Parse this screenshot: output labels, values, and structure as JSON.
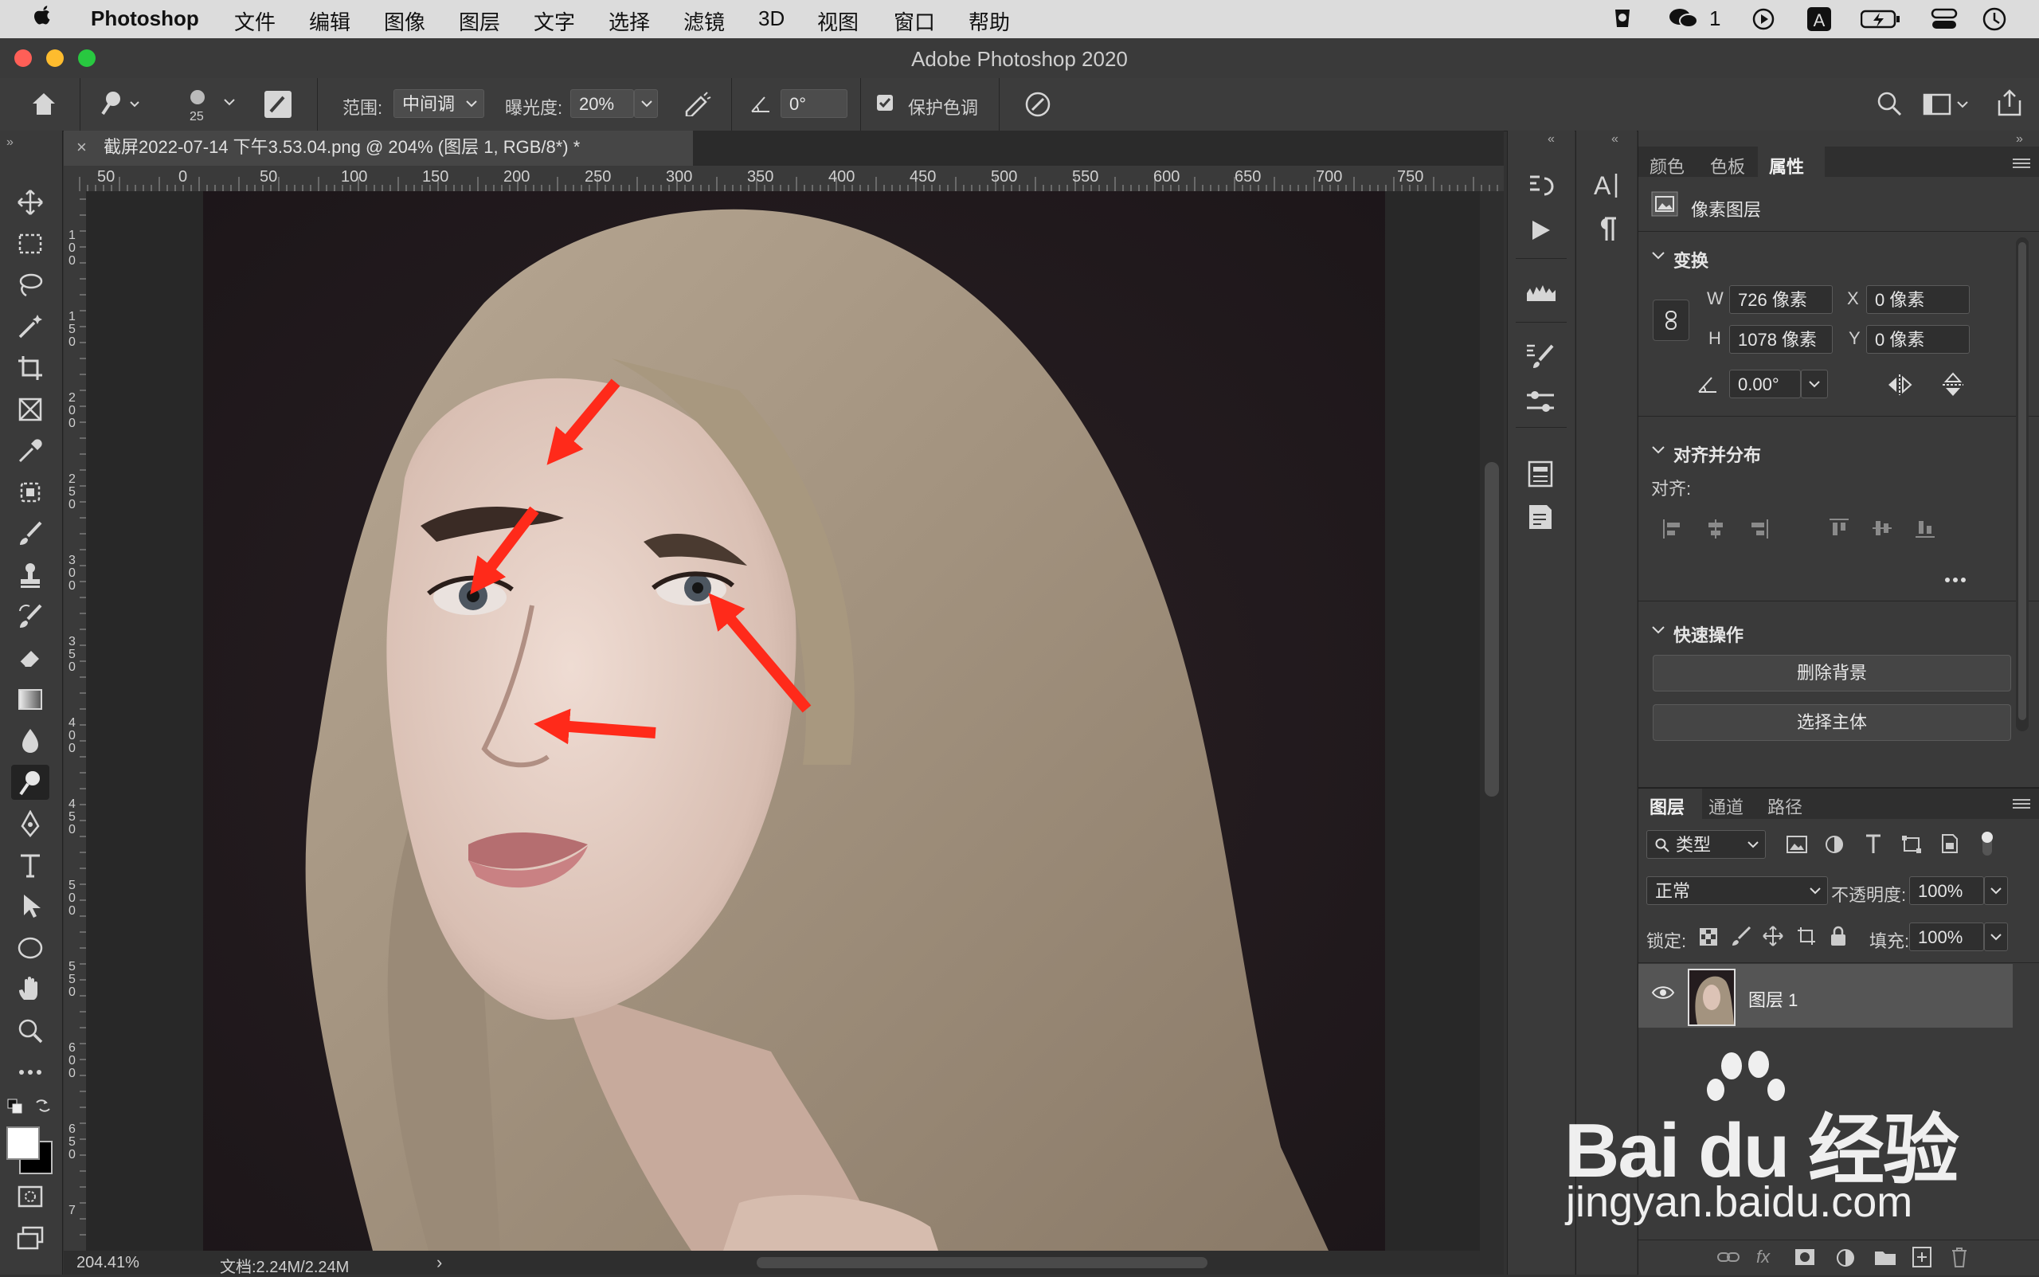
{
  "menubar": {
    "app_name": "Photoshop",
    "items": [
      "文件",
      "编辑",
      "图像",
      "图层",
      "文字",
      "选择",
      "滤镜",
      "3D",
      "视图",
      "窗口",
      "帮助"
    ],
    "wechat_badge": "1"
  },
  "window": {
    "title": "Adobe Photoshop 2020"
  },
  "options_bar": {
    "brush_size": "25",
    "range_label": "范围:",
    "range_value": "中间调",
    "exposure_label": "曝光度:",
    "exposure_value": "20%",
    "angle_value": "0°",
    "protect_tones_label": "保护色调",
    "protect_tones_checked": true
  },
  "document": {
    "tab_title": "截屏2022-07-14 下午3.53.04.png @ 204% (图层 1, RGB/8*) *",
    "zoom": "204.41%",
    "doc_info": "文档:2.24M/2.24M",
    "ruler_labels": [
      "50",
      "0",
      "50",
      "100",
      "150",
      "200",
      "250",
      "300",
      "350",
      "400",
      "450",
      "500",
      "550",
      "600",
      "650",
      "700",
      "750"
    ],
    "vruler_labels": [
      "100",
      "150",
      "200",
      "250",
      "300",
      "350",
      "400",
      "450",
      "500",
      "550",
      "600",
      "650",
      "7"
    ]
  },
  "properties_panel": {
    "tabs": [
      "颜色",
      "色板",
      "属性"
    ],
    "active_tab": "属性",
    "layer_kind": "像素图层",
    "transform_title": "变换",
    "w_label": "W",
    "w_value": "726 像素",
    "h_label": "H",
    "h_value": "1078 像素",
    "x_label": "X",
    "x_value": "0 像素",
    "y_label": "Y",
    "y_value": "0 像素",
    "angle_value": "0.00°",
    "align_title": "对齐并分布",
    "align_label": "对齐:",
    "quick_actions_title": "快速操作",
    "remove_bg_button": "删除背景",
    "select_subject_button": "选择主体"
  },
  "layers_panel": {
    "tabs": [
      "图层",
      "通道",
      "路径"
    ],
    "active_tab": "图层",
    "filter_kind": "类型",
    "blend_mode": "正常",
    "opacity_label": "不透明度:",
    "opacity_value": "100%",
    "lock_label": "锁定:",
    "fill_label": "填充:",
    "fill_value": "100%",
    "layers": [
      {
        "name": "图层 1",
        "visible": true
      }
    ]
  },
  "watermark": {
    "brand": "Bai du 经验",
    "url": "jingyan.baidu.com"
  },
  "colors": {
    "arrow": "#ff2a1a",
    "accent": "#e6e6e6"
  }
}
